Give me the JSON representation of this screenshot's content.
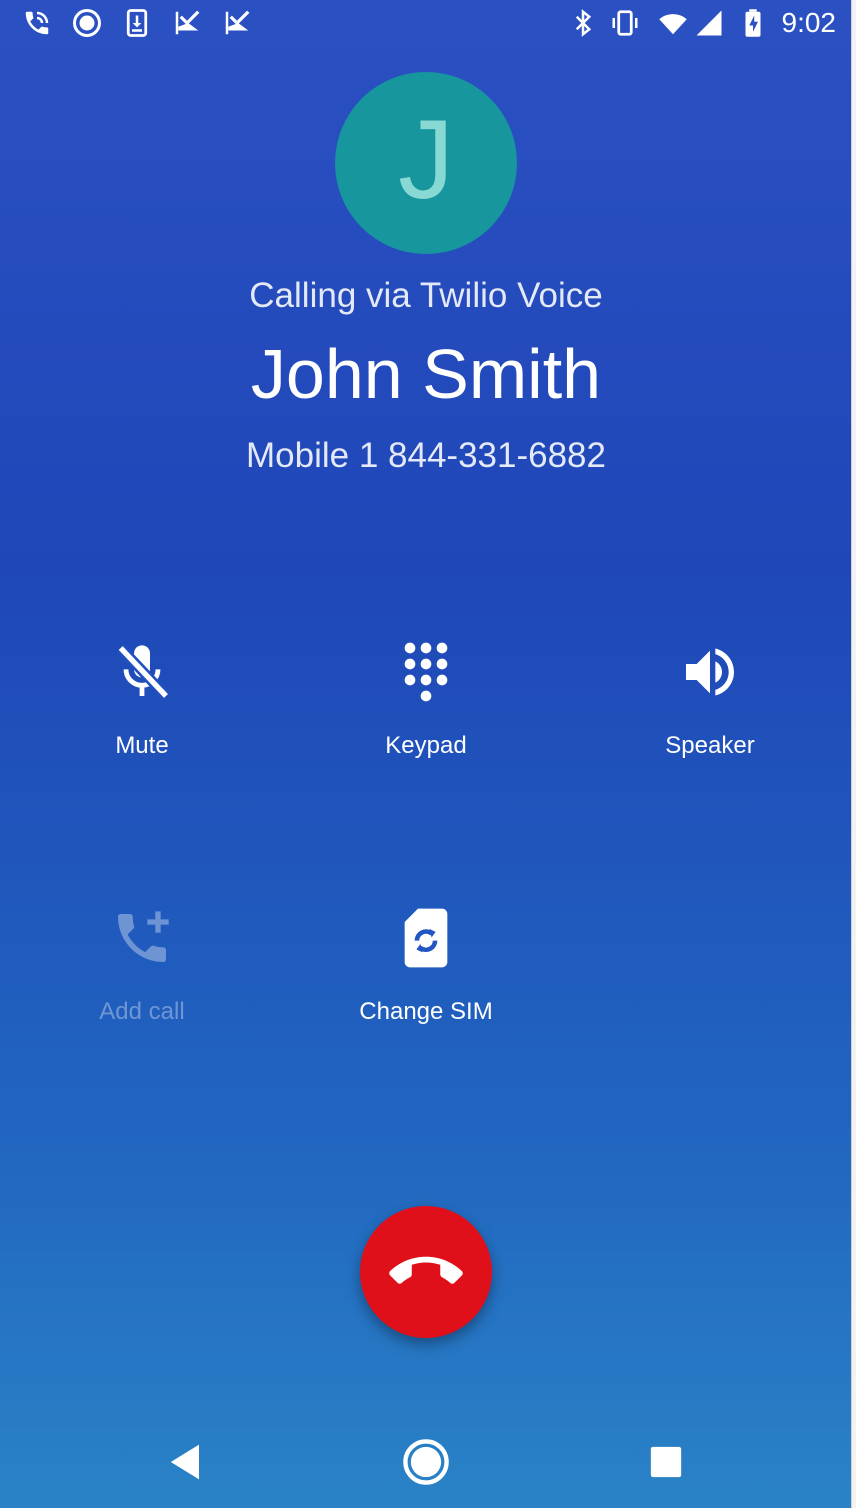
{
  "status_bar": {
    "time": "9:02",
    "left_icons": [
      "phone-call-icon",
      "circle-record-icon",
      "download-icon",
      "check-flag-icon",
      "check-flag-icon-2"
    ],
    "right_icons": [
      "bluetooth-icon",
      "vibrate-icon",
      "wifi-icon",
      "signal-icon",
      "battery-charging-icon"
    ]
  },
  "caller": {
    "avatar_letter": "J",
    "calling_via": "Calling via Twilio Voice",
    "name": "John Smith",
    "number": "Mobile 1 844-331-6882"
  },
  "actions": {
    "mute": "Mute",
    "keypad": "Keypad",
    "speaker": "Speaker",
    "add_call": "Add call",
    "change_sim": "Change SIM"
  },
  "colors": {
    "background_top": "#2b50c2",
    "background_bottom": "#2a83c6",
    "avatar": "#17969e",
    "end_call": "#e0101a"
  },
  "nav": {
    "back": "back-icon",
    "home": "home-icon",
    "recents": "recents-icon"
  }
}
